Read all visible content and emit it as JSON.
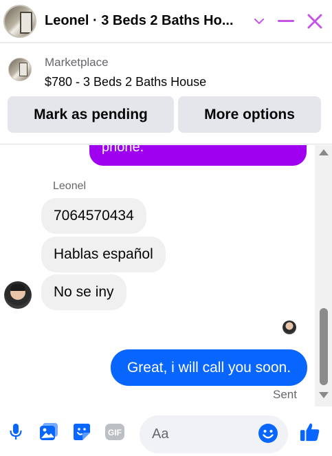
{
  "header": {
    "title": "Leonel · 3 Beds 2 Baths Ho...",
    "colors": {
      "accent": "#c453e6"
    }
  },
  "listing": {
    "label": "Marketplace",
    "price_title": "$780 - 3 Beds 2 Baths House",
    "buttons": {
      "mark_pending": "Mark as pending",
      "more_options": "More options"
    }
  },
  "messages": {
    "outgoing_partial": "phone.",
    "sender_name": "Leonel",
    "incoming": [
      "7064570434",
      "Hablas español",
      "No se iny"
    ],
    "outgoing": "Great, i will call you soon.",
    "status": "Sent",
    "colors": {
      "purple_bubble": "#a000f0",
      "blue_bubble": "#0866ff",
      "incoming_bubble": "#f0f0f0"
    }
  },
  "composer": {
    "placeholder": "Aa",
    "icons": [
      "microphone-icon",
      "photo-icon",
      "sticker-icon",
      "gif-icon",
      "emoji-icon",
      "thumbs-up-icon"
    ],
    "gif_label": "GIF",
    "colors": {
      "icon": "#0866ff"
    }
  }
}
